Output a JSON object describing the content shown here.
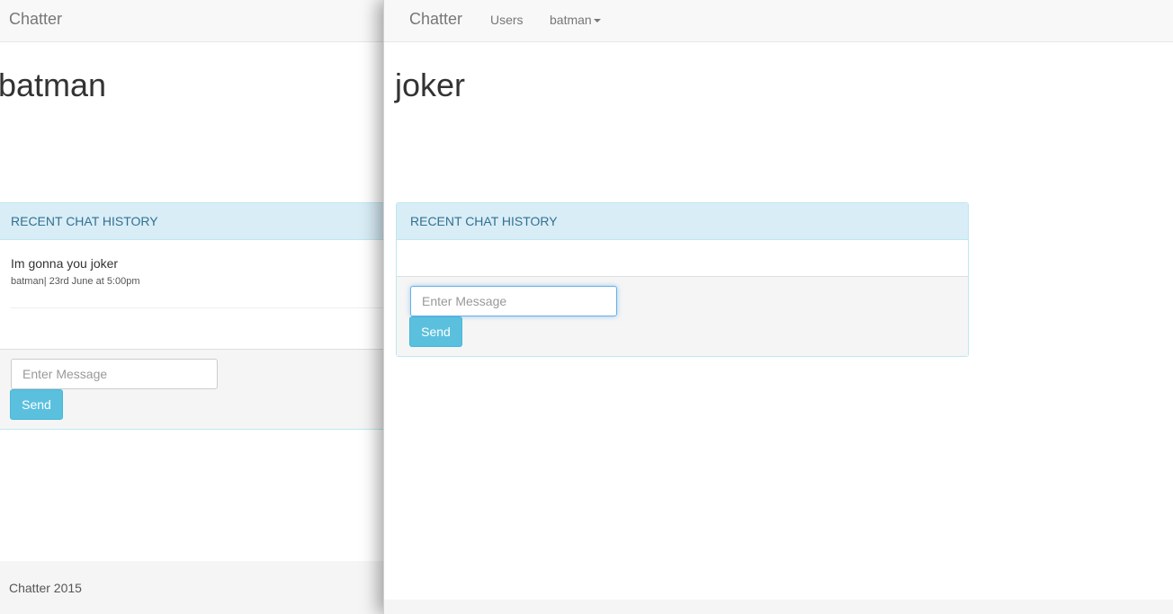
{
  "left_window": {
    "navbar": {
      "brand": "Chatter"
    },
    "title": "batman",
    "panel": {
      "heading": "RECENT CHAT HISTORY",
      "messages": [
        {
          "text": "Im gonna you joker",
          "meta": "batman| 23rd June at 5:00pm"
        }
      ],
      "input_placeholder": "Enter Message",
      "send_label": "Send"
    },
    "footer": {
      "text": "Chatter 2015"
    }
  },
  "right_window": {
    "navbar": {
      "brand": "Chatter",
      "users_link": "Users",
      "user_menu": "batman"
    },
    "title": "joker",
    "panel": {
      "heading": "RECENT CHAT HISTORY",
      "input_placeholder": "Enter Message",
      "send_label": "Send"
    }
  },
  "colors": {
    "accent_info": "#5bc0de",
    "panel_heading_bg": "#d9edf7",
    "panel_heading_text": "#31708f"
  }
}
